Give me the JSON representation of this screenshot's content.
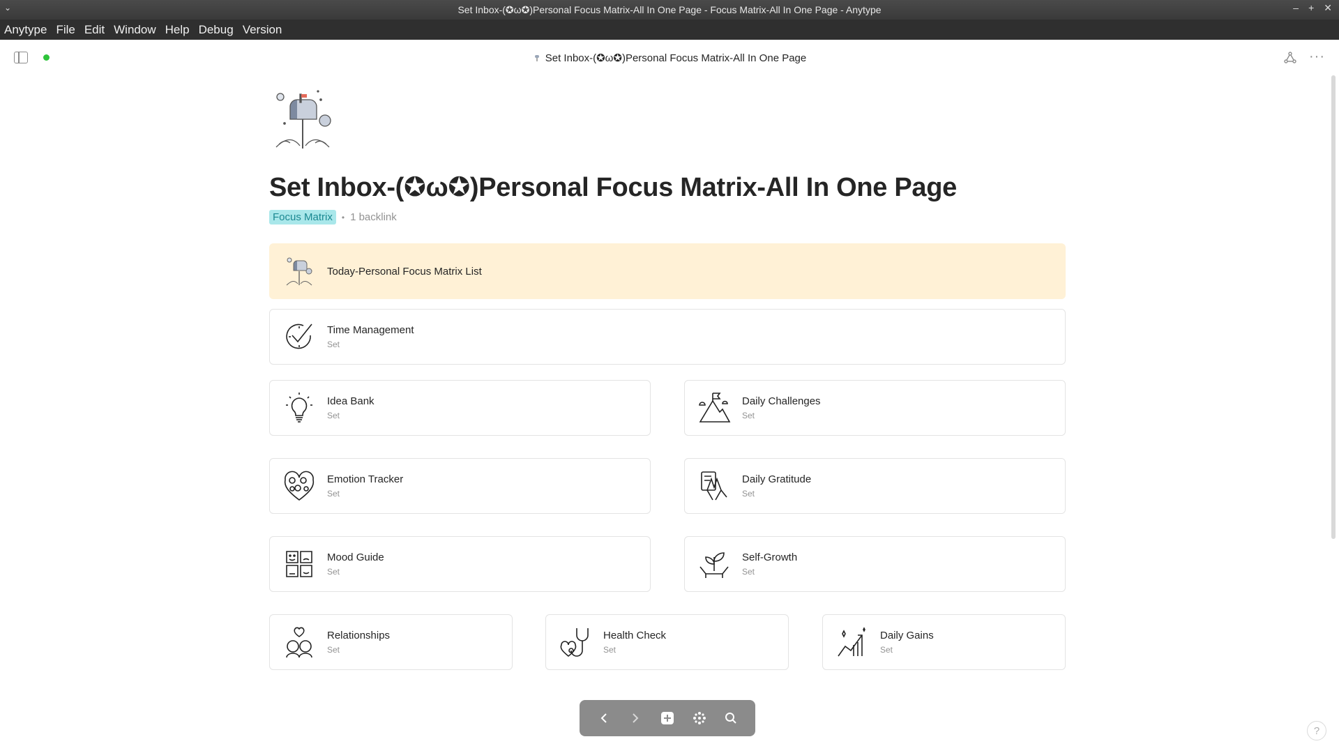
{
  "window": {
    "title": "Set Inbox-(✪ω✪)Personal Focus Matrix-All In One Page - Focus Matrix-All In One Page - Anytype"
  },
  "menubar": [
    "Anytype",
    "File",
    "Edit",
    "Window",
    "Help",
    "Debug",
    "Version"
  ],
  "header": {
    "title": "Set Inbox-(✪ω✪)Personal Focus Matrix-All In One Page"
  },
  "page": {
    "title": "Set Inbox-(✪ω✪)Personal Focus Matrix-All In One Page",
    "type_tag": "Focus Matrix",
    "backlinks": "1 backlink"
  },
  "cards": {
    "today": {
      "title": "Today-Personal Focus Matrix List",
      "icon": "mailbox-icon"
    },
    "time_management": {
      "title": "Time Management",
      "type": "Set",
      "icon": "clock-check-icon"
    },
    "idea_bank": {
      "title": "Idea Bank",
      "type": "Set",
      "icon": "lightbulb-icon"
    },
    "daily_challenges": {
      "title": "Daily Challenges",
      "type": "Set",
      "icon": "mountain-flag-icon"
    },
    "emotion_tracker": {
      "title": "Emotion Tracker",
      "type": "Set",
      "icon": "heart-faces-icon"
    },
    "daily_gratitude": {
      "title": "Daily Gratitude",
      "type": "Set",
      "icon": "prayer-hands-icon"
    },
    "mood_guide": {
      "title": "Mood Guide",
      "type": "Set",
      "icon": "mood-faces-icon"
    },
    "self_growth": {
      "title": "Self-Growth",
      "type": "Set",
      "icon": "sprout-hands-icon"
    },
    "relationships": {
      "title": "Relationships",
      "type": "Set",
      "icon": "couple-heart-icon"
    },
    "health_check": {
      "title": "Health Check",
      "type": "Set",
      "icon": "stethoscope-icon"
    },
    "daily_gains": {
      "title": "Daily Gains",
      "type": "Set",
      "icon": "chart-up-icon"
    }
  },
  "colors": {
    "accent_tag_bg": "#a9e7ea",
    "accent_tag_text": "#1b8891",
    "highlight_card_bg": "#fff1d6",
    "sync_dot": "#2ec43b"
  },
  "help_label": "?"
}
